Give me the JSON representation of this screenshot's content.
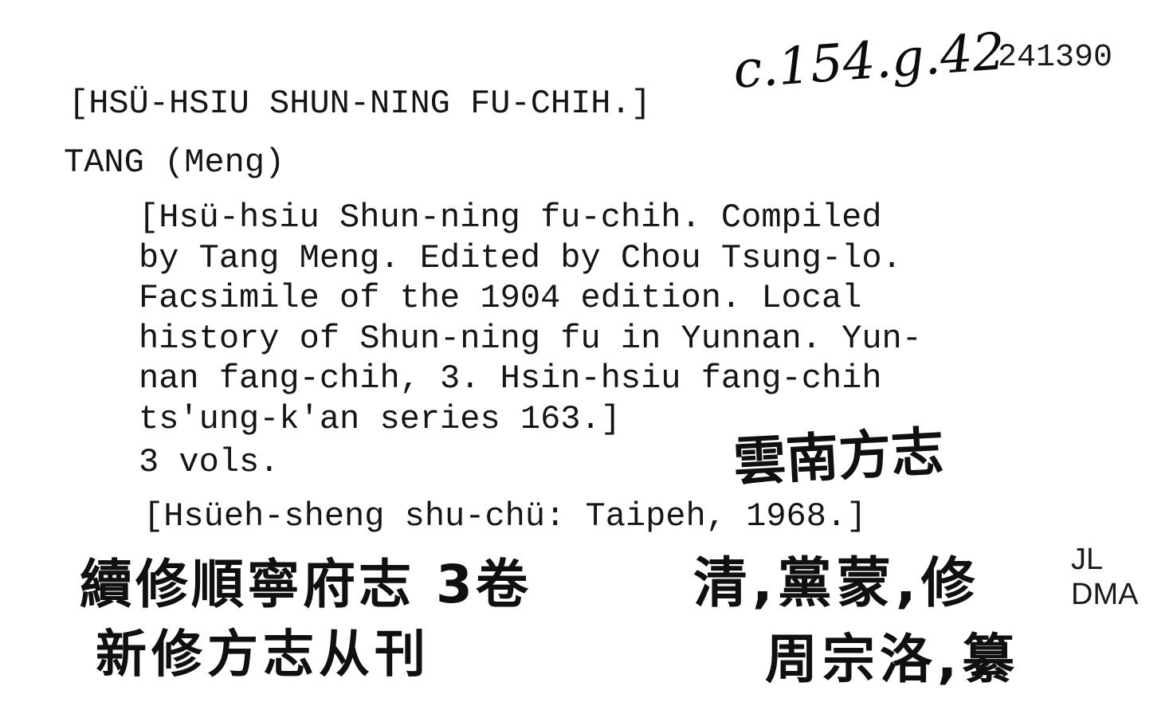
{
  "card": {
    "shelfmark": "c.154.g.42",
    "accession": "241390",
    "heading_title": "[HSÜ-HSIU SHUN-NING FU-CHIH.]",
    "author": "TANG (Meng)",
    "description_lines": [
      "[Hsü-hsiu Shun-ning fu-chih. Compiled",
      "by Tang Meng. Edited by Chou Tsung-lo.",
      "Facsimile of the 1904 edition. Local",
      "history of Shun-ning fu in Yunnan. Yun-",
      "nan fang-chih, 3. Hsin-hsiu fang-chih",
      "ts'ung-k'an series 163.]"
    ],
    "volumes": "3 vols.",
    "imprint": "[Hsüeh-sheng shu-chü: Taipeh, 1968.]",
    "handwritten_chinese": {
      "series_note": "雲南方志",
      "title_line": "續修順寧府志 3卷",
      "series_line": "新修方志从刊",
      "author_line": "清,黨蒙,修",
      "editor_line": "周宗洛,纂"
    },
    "initials": [
      "JL",
      "DMA"
    ]
  }
}
